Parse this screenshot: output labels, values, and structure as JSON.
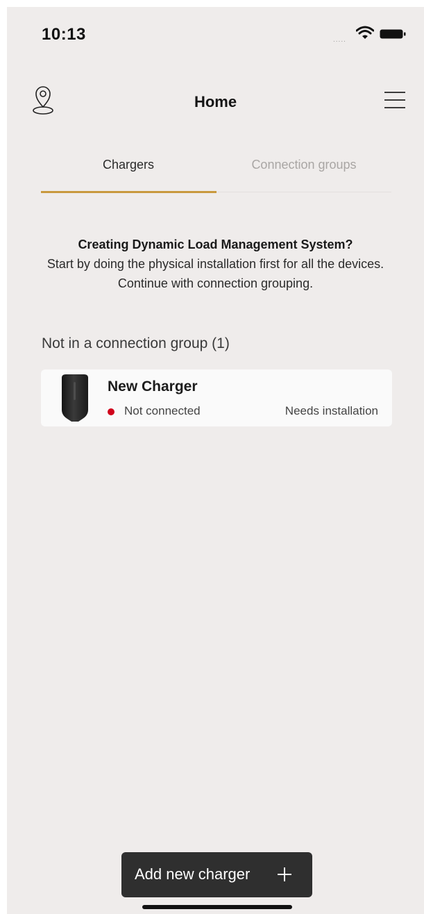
{
  "status_bar": {
    "time": "10:13",
    "signal": "....."
  },
  "nav": {
    "title": "Home",
    "left_icon": "location-pin-icon",
    "right_icon": "hamburger-menu-icon"
  },
  "tabs": [
    {
      "label": "Chargers",
      "active": true
    },
    {
      "label": "Connection groups",
      "active": false
    }
  ],
  "info": {
    "title": "Creating Dynamic Load Management System?",
    "body": "Start by doing the physical installation first for all the devices. Continue with connection grouping."
  },
  "section": {
    "label": "Not in a connection group (1)"
  },
  "charger": {
    "name": "New Charger",
    "status": "Not connected",
    "status_color": "#d0021b",
    "installation": "Needs installation"
  },
  "add_button": {
    "label": "Add new charger",
    "icon": "plus-icon"
  },
  "colors": {
    "accent": "#c9993e",
    "background": "#efeceb",
    "button": "#2f2f2f"
  }
}
